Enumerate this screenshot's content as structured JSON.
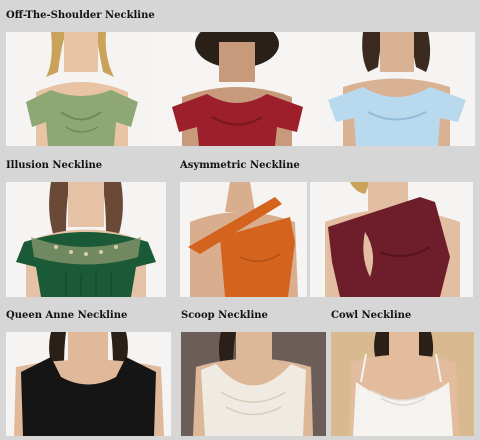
{
  "sections": {
    "off_shoulder": {
      "label": "Off-The-Shoulder Neckline",
      "photos": [
        {
          "dress_color": "#8da874",
          "skin": "#e8c4a4",
          "hair": "#c9a35a"
        },
        {
          "dress_color": "#9c1f2b",
          "skin": "#c89a7c",
          "hair": "#2a2018"
        },
        {
          "dress_color": "#b9d9ef",
          "skin": "#d9b293",
          "hair": "#3a2a20"
        }
      ]
    },
    "illusion": {
      "label": "Illusion Neckline",
      "photos": [
        {
          "dress_color": "#1b5a36",
          "skin": "#e5c2a6",
          "hair": "#6a4a36"
        }
      ]
    },
    "asymmetric": {
      "label": "Asymmetric Neckline",
      "photos": [
        {
          "dress_color": "#d4631e",
          "skin": "#d8ae8e",
          "hair": "#3a2a20"
        },
        {
          "dress_color": "#6e1d2a",
          "skin": "#e2bfa2",
          "hair": "#c9a35a"
        }
      ]
    },
    "queen_anne": {
      "label": "Queen Anne Neckline",
      "photos": [
        {
          "dress_color": "#151515",
          "skin": "#e0b89a",
          "hair": "#2a2018"
        }
      ]
    },
    "scoop": {
      "label": "Scoop Neckline",
      "photos": [
        {
          "dress_color": "#f0ebe2",
          "skin": "#ddb898",
          "hair": "#2a2018"
        }
      ]
    },
    "cowl": {
      "label": "Cowl Neckline",
      "photos": [
        {
          "dress_color": "#f5f3f0",
          "skin": "#e2bc9c",
          "hair": "#2a2018"
        }
      ]
    }
  }
}
